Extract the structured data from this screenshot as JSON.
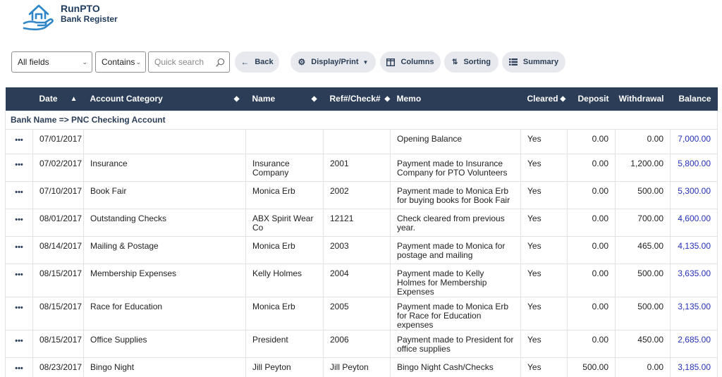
{
  "header": {
    "app_name": "RunPTO",
    "page_title": "Bank Register"
  },
  "toolbar": {
    "field_select": "All fields",
    "operator_select": "Contains",
    "search_placeholder": "Quick search",
    "back_label": "Back",
    "display_label": "Display/Print",
    "columns_label": "Columns",
    "sorting_label": "Sorting",
    "summary_label": "Summary"
  },
  "table": {
    "headers": {
      "date": "Date",
      "category": "Account Category",
      "name": "Name",
      "ref": "Ref#/Check#",
      "memo": "Memo",
      "cleared": "Cleared",
      "deposit": "Deposit",
      "withdrawal": "Withdrawal",
      "balance": "Balance"
    },
    "group_label": "Bank Name => PNC Checking Account",
    "rows": [
      {
        "date": "07/01/2017",
        "category": "",
        "name": "",
        "ref": "",
        "memo": "Opening Balance",
        "cleared": "Yes",
        "deposit": "0.00",
        "withdrawal": "0.00",
        "balance": "7,000.00"
      },
      {
        "date": "07/02/2017",
        "category": "Insurance",
        "name": "Insurance Company",
        "ref": "2001",
        "memo": "Payment made to Insurance Company for PTO Volunteers",
        "cleared": "Yes",
        "deposit": "0.00",
        "withdrawal": "1,200.00",
        "balance": "5,800.00"
      },
      {
        "date": "07/10/2017",
        "category": "Book Fair",
        "name": "Monica Erb",
        "ref": "2002",
        "memo": "Payment made to Monica Erb for buying books for Book Fair",
        "cleared": "Yes",
        "deposit": "0.00",
        "withdrawal": "500.00",
        "balance": "5,300.00"
      },
      {
        "date": "08/01/2017",
        "category": "Outstanding Checks",
        "name": "ABX Spirit Wear Co",
        "ref": "12121",
        "memo": "Check cleared from previous year.",
        "cleared": "Yes",
        "deposit": "0.00",
        "withdrawal": "700.00",
        "balance": "4,600.00"
      },
      {
        "date": "08/14/2017",
        "category": "Mailing & Postage",
        "name": "Monica Erb",
        "ref": "2003",
        "memo": "Payment made to Monica for postage and mailing",
        "cleared": "Yes",
        "deposit": "0.00",
        "withdrawal": "465.00",
        "balance": "4,135.00"
      },
      {
        "date": "08/15/2017",
        "category": "Membership Expenses",
        "name": "Kelly Holmes",
        "ref": "2004",
        "memo": "Payment made to Kelly Holmes for Membership Expenses",
        "cleared": "Yes",
        "deposit": "0.00",
        "withdrawal": "500.00",
        "balance": "3,635.00"
      },
      {
        "date": "08/15/2017",
        "category": "Race for Education",
        "name": "Monica Erb",
        "ref": "2005",
        "memo": "Payment made to Monica Erb for Race for Education expenses",
        "cleared": "Yes",
        "deposit": "0.00",
        "withdrawal": "500.00",
        "balance": "3,135.00"
      },
      {
        "date": "08/15/2017",
        "category": "Office Supplies",
        "name": "President",
        "ref": "2006",
        "memo": "Payment made to President for office supplies",
        "cleared": "Yes",
        "deposit": "0.00",
        "withdrawal": "450.00",
        "balance": "2,685.00"
      },
      {
        "date": "08/23/2017",
        "category": "Bingo Night",
        "name": "Jill Peyton",
        "ref": "Jill Peyton",
        "memo": "Bingo Night Cash/Checks",
        "cleared": "Yes",
        "deposit": "500.00",
        "withdrawal": "0.00",
        "balance": "3,185.00"
      }
    ]
  },
  "icons": {
    "logo": "house-hand-logo",
    "search": "search-icon",
    "back": "arrow-left-icon",
    "display": "gear-icon",
    "columns": "columns-icon",
    "sorting": "sort-icon",
    "summary": "list-icon",
    "row_menu": "more-dots-icon"
  },
  "colors": {
    "brand": "#2c3e57",
    "header_bg": "#2c3e57",
    "balance_link": "#2430b8",
    "button_bg": "#e7e9ee"
  }
}
